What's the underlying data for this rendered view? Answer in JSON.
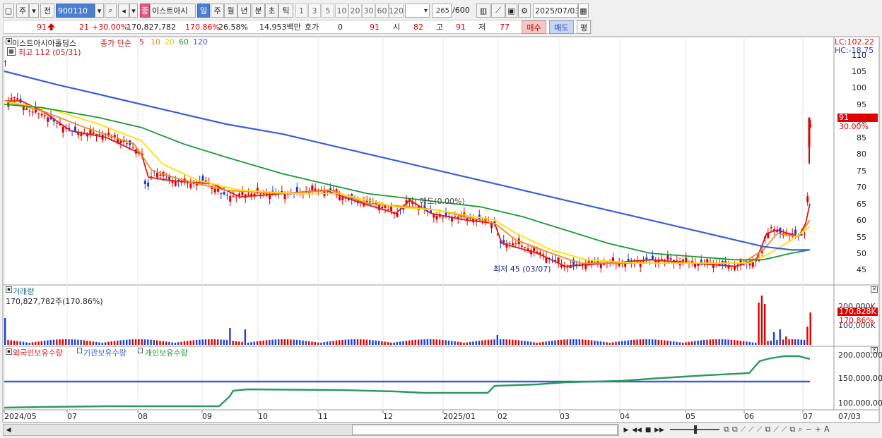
{
  "toolbar": {
    "period_label": "주",
    "market_label": "전",
    "code": "900110",
    "stock_name": "이스트아시",
    "stock_badge": "종",
    "periods": [
      "일",
      "주",
      "월",
      "년",
      "분",
      "초",
      "틱"
    ],
    "minutes": [
      "1",
      "3",
      "5",
      "10",
      "20",
      "30",
      "60",
      "120"
    ],
    "count": "265",
    "count_total": "/600",
    "date": "2025/07/03"
  },
  "quote": {
    "price": "91",
    "change": "21",
    "change_pct": "+30.00%",
    "volume": "170,827,782",
    "volume_ratio": "170.86%",
    "turnover": "26.58%",
    "amount": "14,953백만",
    "hoga_label": "호가",
    "hoga_value": "0",
    "hoga_price": "91",
    "open_label": "시",
    "open": "82",
    "high_label": "고",
    "high": "91",
    "low_label": "저",
    "low": "77",
    "buy_label": "매수",
    "sell_label": "매도",
    "eval_label": "평"
  },
  "price_panel": {
    "stock_label": "이스트아시아홀딩스",
    "ma_label": "종가 단순",
    "ma_periods": [
      "5",
      "10",
      "20",
      "60",
      "120"
    ],
    "ma_colors": [
      "#e01818",
      "#f08c1c",
      "#ffe000",
      "#1a9a32",
      "#3a5fd8"
    ],
    "high_note": "최고 112 (05/31)",
    "low_note": "최저 45 (03/07)",
    "mid_note": "매도(0.00%)",
    "lc": "LC:102.22",
    "hc": "HC:-18.75",
    "y_ticks": [
      "110",
      "105",
      "100",
      "95",
      "90",
      "85",
      "80",
      "75",
      "70",
      "65",
      "60",
      "55",
      "50",
      "45"
    ],
    "last_price_tag": "91",
    "last_pct_tag": "30.00%"
  },
  "volume_panel": {
    "title": "거래량",
    "value_label": "170,827,782주(170.86%)",
    "y_ticks": [
      "200,000K",
      "100,000K"
    ],
    "last_tag": "170,828K",
    "last_pct_tag": "170.86%"
  },
  "holding_panel": {
    "series": [
      "외국인보유수량",
      "기관보유수량",
      "개인보유수량"
    ],
    "series_colors": [
      "#e01818",
      "#3a5fd8",
      "#1a9a32"
    ],
    "y_ticks": [
      "200,000,00",
      "150,000,00",
      "100,000,00"
    ]
  },
  "x_axis": {
    "labels": [
      "2024/05",
      "07",
      "08",
      "09",
      "10",
      "11",
      "12",
      "2025/01",
      "02",
      "03",
      "04",
      "05",
      "06",
      "07"
    ],
    "end_label": "07/03"
  }
}
